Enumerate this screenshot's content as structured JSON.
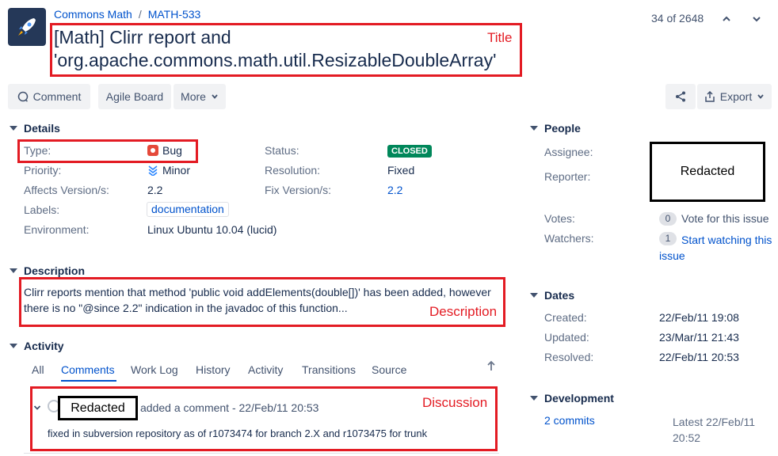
{
  "breadcrumb": {
    "project": "Commons Math",
    "sep": "/",
    "issue_key": "MATH-533"
  },
  "pager": {
    "position": "34 of 2648"
  },
  "title": {
    "line1": "[Math] Clirr report and",
    "line2": "'org.apache.commons.math.util.ResizableDoubleArray'"
  },
  "annotations": {
    "title": "Title",
    "description": "Description",
    "discussion": "Discussion",
    "redacted": "Redacted"
  },
  "toolbar": {
    "comment": "Comment",
    "agile_board": "Agile Board",
    "more": "More",
    "export": "Export"
  },
  "details": {
    "heading": "Details",
    "type_label": "Type:",
    "type_value": "Bug",
    "status_label": "Status:",
    "status_value": "CLOSED",
    "priority_label": "Priority:",
    "priority_value": "Minor",
    "resolution_label": "Resolution:",
    "resolution_value": "Fixed",
    "affects_label": "Affects Version/s:",
    "affects_value": "2.2",
    "fix_label": "Fix Version/s:",
    "fix_value": "2.2",
    "labels_label": "Labels:",
    "labels_value": "documentation",
    "environment_label": "Environment:",
    "environment_value": "Linux Ubuntu 10.04 (lucid)"
  },
  "description": {
    "heading": "Description",
    "line1": "Clirr reports mention that method 'public void addElements(double[])' has been added, however",
    "line2": "there is no \"@since 2.2\" indication in the javadoc of this function..."
  },
  "activity": {
    "heading": "Activity",
    "tabs": [
      "All",
      "Comments",
      "Work Log",
      "History",
      "Activity",
      "Transitions",
      "Source"
    ],
    "comment_meta": "added a comment - 22/Feb/11 20:53",
    "comment_body": "fixed in subversion repository as of r1073474 for branch 2.X and r1073475 for trunk"
  },
  "people": {
    "heading": "People",
    "assignee_label": "Assignee:",
    "reporter_label": "Reporter:",
    "votes_label": "Votes:",
    "votes_count": "0",
    "votes_action": "Vote for this issue",
    "watchers_label": "Watchers:",
    "watchers_count": "1",
    "watchers_action_1": "Start watching this",
    "watchers_action_2": "issue"
  },
  "dates": {
    "heading": "Dates",
    "created_label": "Created:",
    "created_value": "22/Feb/11 19:08",
    "updated_label": "Updated:",
    "updated_value": "23/Mar/11 21:43",
    "resolved_label": "Resolved:",
    "resolved_value": "22/Feb/11 20:53"
  },
  "development": {
    "heading": "Development",
    "commits": "2 commits",
    "latest_1": "Latest 22/Feb/11",
    "latest_2": "20:52"
  },
  "colors": {
    "annotation_red": "#e31b23",
    "link_blue": "#0052cc",
    "status_green": "#00875a",
    "bug_red": "#e5493a",
    "avatar_bg": "#253858"
  }
}
